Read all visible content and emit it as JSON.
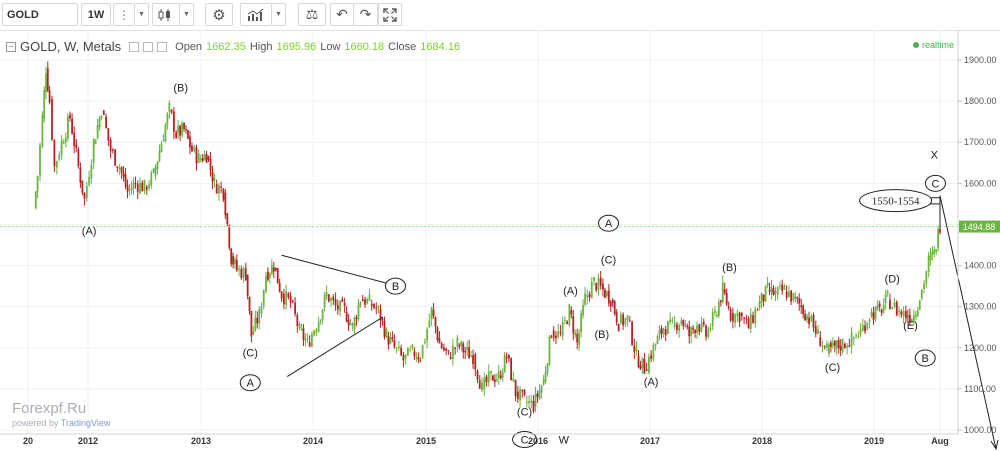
{
  "toolbar": {
    "symbol": "GOLD",
    "interval": "1W",
    "icons": [
      "caret-down-icon",
      "candles-icon",
      "caret-down-icon",
      "gear-icon",
      "indicators-icon",
      "caret-down-icon",
      "scales-icon",
      "undo-icon",
      "redo-icon",
      "fullscreen-icon"
    ]
  },
  "header": {
    "title": "GOLD, W, Metals",
    "open_label": "Open",
    "open": "1662.35",
    "high_label": "High",
    "high": "1695.96",
    "low_label": "Low",
    "low": "1660.18",
    "close_label": "Close",
    "close": "1684.16",
    "realtime": "realtime",
    "value_color": "#7ed321"
  },
  "watermark": {
    "brand": "Forexpf.Ru",
    "powered_prefix": "powered by ",
    "powered_by": "TradingView"
  },
  "current_price_label": "1494.88",
  "colors": {
    "up": "#6cb33f",
    "down": "#b22222",
    "price_line": "#90ee90",
    "axis_text": "#555555"
  },
  "chart_data": {
    "type": "candlestick",
    "title": "GOLD, W, Metals",
    "interval": "1W",
    "ylim": [
      1000,
      1900
    ],
    "y_ticks": [
      "1900.00",
      "1800.00",
      "1700.00",
      "1600.00",
      "1500.00",
      "1400.00",
      "1300.00",
      "1200.00",
      "1100.00",
      "1000.00"
    ],
    "x_ticks": [
      "20",
      "2012",
      "2013",
      "2014",
      "2015",
      "2016",
      "2017",
      "2018",
      "2019",
      "Aug"
    ],
    "current_price": 1494.88,
    "series": [
      {
        "values": [
          [
            2011.55,
            1540
          ],
          [
            2011.58,
            1620
          ],
          [
            2011.62,
            1760
          ],
          [
            2011.65,
            1880
          ],
          [
            2011.68,
            1800
          ],
          [
            2011.72,
            1640
          ],
          [
            2011.78,
            1700
          ],
          [
            2011.85,
            1760
          ],
          [
            2011.92,
            1640
          ],
          [
            2011.97,
            1560
          ],
          [
            2012.05,
            1700
          ],
          [
            2012.12,
            1780
          ],
          [
            2012.2,
            1680
          ],
          [
            2012.28,
            1640
          ],
          [
            2012.35,
            1580
          ],
          [
            2012.42,
            1600
          ],
          [
            2012.5,
            1590
          ],
          [
            2012.58,
            1620
          ],
          [
            2012.65,
            1700
          ],
          [
            2012.72,
            1780
          ],
          [
            2012.78,
            1720
          ],
          [
            2012.85,
            1730
          ],
          [
            2012.92,
            1680
          ],
          [
            2012.98,
            1660
          ],
          [
            2013.05,
            1670
          ],
          [
            2013.12,
            1600
          ],
          [
            2013.2,
            1580
          ],
          [
            2013.27,
            1420
          ],
          [
            2013.32,
            1390
          ],
          [
            2013.4,
            1380
          ],
          [
            2013.45,
            1230
          ],
          [
            2013.52,
            1280
          ],
          [
            2013.58,
            1380
          ],
          [
            2013.65,
            1400
          ],
          [
            2013.72,
            1330
          ],
          [
            2013.8,
            1310
          ],
          [
            2013.88,
            1240
          ],
          [
            2013.95,
            1210
          ],
          [
            2014.05,
            1270
          ],
          [
            2014.12,
            1330
          ],
          [
            2014.2,
            1300
          ],
          [
            2014.28,
            1290
          ],
          [
            2014.35,
            1250
          ],
          [
            2014.42,
            1320
          ],
          [
            2014.5,
            1310
          ],
          [
            2014.58,
            1290
          ],
          [
            2014.65,
            1230
          ],
          [
            2014.72,
            1200
          ],
          [
            2014.8,
            1170
          ],
          [
            2014.88,
            1190
          ],
          [
            2014.95,
            1180
          ],
          [
            2015.05,
            1290
          ],
          [
            2015.12,
            1210
          ],
          [
            2015.2,
            1180
          ],
          [
            2015.28,
            1210
          ],
          [
            2015.35,
            1190
          ],
          [
            2015.42,
            1180
          ],
          [
            2015.5,
            1100
          ],
          [
            2015.58,
            1130
          ],
          [
            2015.65,
            1130
          ],
          [
            2015.72,
            1180
          ],
          [
            2015.8,
            1090
          ],
          [
            2015.88,
            1070
          ],
          [
            2015.96,
            1060
          ],
          [
            2016.05,
            1120
          ],
          [
            2016.12,
            1240
          ],
          [
            2016.2,
            1230
          ],
          [
            2016.28,
            1290
          ],
          [
            2016.35,
            1210
          ],
          [
            2016.42,
            1320
          ],
          [
            2016.5,
            1360
          ],
          [
            2016.58,
            1340
          ],
          [
            2016.65,
            1320
          ],
          [
            2016.72,
            1260
          ],
          [
            2016.8,
            1270
          ],
          [
            2016.88,
            1180
          ],
          [
            2016.95,
            1150
          ],
          [
            2017.05,
            1210
          ],
          [
            2017.12,
            1250
          ],
          [
            2017.2,
            1250
          ],
          [
            2017.28,
            1270
          ],
          [
            2017.35,
            1230
          ],
          [
            2017.42,
            1260
          ],
          [
            2017.5,
            1230
          ],
          [
            2017.58,
            1280
          ],
          [
            2017.65,
            1340
          ],
          [
            2017.72,
            1280
          ],
          [
            2017.8,
            1280
          ],
          [
            2017.88,
            1250
          ],
          [
            2017.96,
            1300
          ],
          [
            2018.05,
            1340
          ],
          [
            2018.12,
            1330
          ],
          [
            2018.2,
            1340
          ],
          [
            2018.28,
            1320
          ],
          [
            2018.35,
            1300
          ],
          [
            2018.42,
            1270
          ],
          [
            2018.5,
            1230
          ],
          [
            2018.58,
            1190
          ],
          [
            2018.65,
            1200
          ],
          [
            2018.72,
            1210
          ],
          [
            2018.8,
            1220
          ],
          [
            2018.88,
            1240
          ],
          [
            2018.96,
            1280
          ],
          [
            2019.05,
            1290
          ],
          [
            2019.12,
            1320
          ],
          [
            2019.2,
            1290
          ],
          [
            2019.28,
            1280
          ],
          [
            2019.35,
            1280
          ],
          [
            2019.42,
            1340
          ],
          [
            2019.48,
            1410
          ],
          [
            2019.53,
            1430
          ],
          [
            2019.58,
            1500
          ]
        ]
      }
    ]
  },
  "annotations": [
    {
      "text": "(A)",
      "t": 2012.01,
      "p": 1485,
      "circle": false
    },
    {
      "text": "(B)",
      "t": 2012.82,
      "p": 1833,
      "circle": false
    },
    {
      "text": "(C)",
      "t": 2013.44,
      "p": 1188,
      "circle": false
    },
    {
      "text": "A",
      "t": 2013.44,
      "p": 1115,
      "circle": true
    },
    {
      "text": "B",
      "t": 2014.73,
      "p": 1350,
      "circle": true
    },
    {
      "text": "(C)",
      "t": 2015.88,
      "p": 1045,
      "circle": false
    },
    {
      "text": "C",
      "t": 2015.88,
      "p": 977,
      "circle": true
    },
    {
      "text": "W",
      "t": 2016.23,
      "p": 977,
      "circle": false
    },
    {
      "text": "(A)",
      "t": 2016.29,
      "p": 1339,
      "circle": false
    },
    {
      "text": "A",
      "t": 2016.63,
      "p": 1503,
      "circle": true
    },
    {
      "text": "(C)",
      "t": 2016.63,
      "p": 1415,
      "circle": false
    },
    {
      "text": "(B)",
      "t": 2016.57,
      "p": 1233,
      "circle": false
    },
    {
      "text": "(A)",
      "t": 2017.01,
      "p": 1118,
      "circle": false
    },
    {
      "text": "(B)",
      "t": 2017.71,
      "p": 1396,
      "circle": false
    },
    {
      "text": "(C)",
      "t": 2018.63,
      "p": 1153,
      "circle": false
    },
    {
      "text": "(D)",
      "t": 2019.16,
      "p": 1369,
      "circle": false
    },
    {
      "text": "(E)",
      "t": 2019.32,
      "p": 1255,
      "circle": false
    },
    {
      "text": "B",
      "t": 2019.45,
      "p": 1175,
      "circle": true
    },
    {
      "text": "X",
      "t": 2019.53,
      "p": 1670,
      "circle": false
    },
    {
      "text": "C",
      "t": 2019.54,
      "p": 1600,
      "circle": true
    }
  ],
  "target_zone_label": "1550-1554"
}
